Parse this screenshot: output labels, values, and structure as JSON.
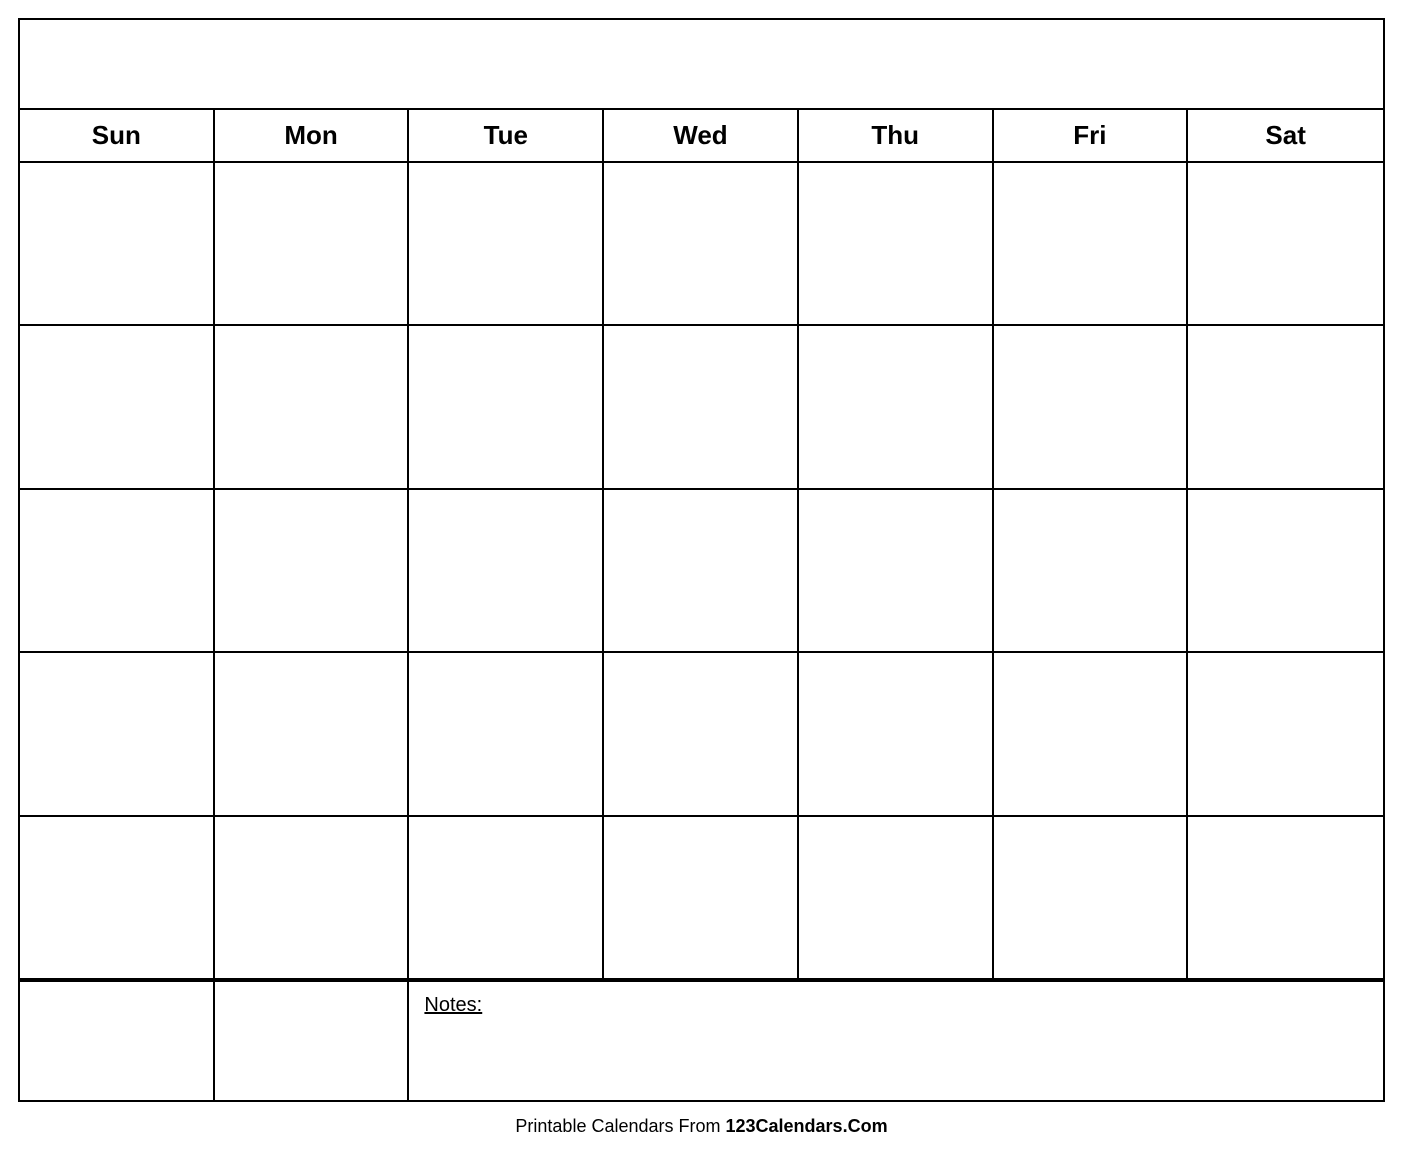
{
  "calendar": {
    "title": "",
    "headers": [
      "Sun",
      "Mon",
      "Tue",
      "Wed",
      "Thu",
      "Fri",
      "Sat"
    ],
    "weeks": [
      [
        "",
        "",
        "",
        "",
        "",
        "",
        ""
      ],
      [
        "",
        "",
        "",
        "",
        "",
        "",
        ""
      ],
      [
        "",
        "",
        "",
        "",
        "",
        "",
        ""
      ],
      [
        "",
        "",
        "",
        "",
        "",
        "",
        ""
      ],
      [
        "",
        "",
        "",
        "",
        "",
        "",
        ""
      ]
    ],
    "notes_label": "Notes:",
    "footer_text": "Printable Calendars From ",
    "footer_brand": "123Calendars.Com"
  }
}
